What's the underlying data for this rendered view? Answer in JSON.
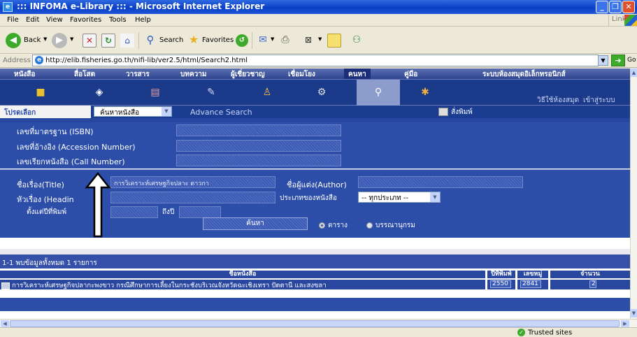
{
  "window": {
    "title": "::: INFOMA e-Library ::: - Microsoft Internet Explorer"
  },
  "menu": [
    "File",
    "Edit",
    "View",
    "Favorites",
    "Tools",
    "Help"
  ],
  "menu_links": "Links",
  "toolbar": {
    "back": "Back",
    "search": "Search",
    "favorites": "Favorites"
  },
  "address": {
    "label": "Address",
    "url": "http://elib.fisheries.go.th/nifi-lib/ver2.5/html/Search2.html",
    "go": "Go"
  },
  "nav_tabs": [
    "หนังสือ",
    "สื่อโสต",
    "วารสาร",
    "บทความ",
    "ผู้เชี่ยวชาญ",
    "เชื่อมโยง",
    "คนหา",
    "คู่มือ"
  ],
  "nav_right": "ระบบห้องสมุดอิเล็กทรอนิกส์",
  "icon_links": {
    "howto": "วิธีใช้ห้องสมุด",
    "login": "เข้าสู่ระบบ"
  },
  "form": {
    "current_tab": "โปรดเลือก",
    "search_type": "ค้นหาหนังสือ",
    "advance_search": "Advance Search",
    "print": "สั่งพิมพ์",
    "isbn_label": "เลขที่มาตรฐาน (ISBN)",
    "accession_label": "เลขที่อ้างอิง (Accession Number)",
    "call_label": "เลขเรียกหนังสือ (Call Number)",
    "title_label": "ชื่อเรื่อง(Title)",
    "title_value": "การวิเคราะห์เศรษฐกิจปลาะ ตาวกา",
    "author_label": "ชื่อผู้แต่ง(Author)",
    "heading_label": "หัวเรื่อง (Headin",
    "booktype_label": "ประเภทของหนังสือ",
    "booktype_value": "-- ทุกประเภท --",
    "from_year_label": "ตั้งแต่ปีที่พิมพ์",
    "to_year_label": "ถึงปี",
    "search_button": "ค้นหา",
    "radio_table": "ตาราง",
    "radio_biblio": "บรรณานุกรม"
  },
  "results": {
    "summary": "1-1  พบข้อมูลทั้งหมด 1 รายการ",
    "headers": {
      "title": "ชื่อหนังสือ",
      "year": "ปีที่พิมพ์",
      "callno": "เลขหมู่",
      "count": "จำนวน"
    },
    "rows": [
      {
        "title": "การวิเคราะห์เศรษฐกิจปลากะพงขาว กรณีศึกษาการเลี้ยงในกระชังบริเวณจังหวัดฉะเชิงเทรา ปัตตานี และสงขลา",
        "year": "2550",
        "callno": "2841",
        "count": "2"
      }
    ]
  },
  "status": {
    "zone": "Trusted sites"
  },
  "colors": {
    "page_blue": "#2C4EA8",
    "nav_blue": "#1B3A8A",
    "titlebar": "#0A3FC7"
  }
}
